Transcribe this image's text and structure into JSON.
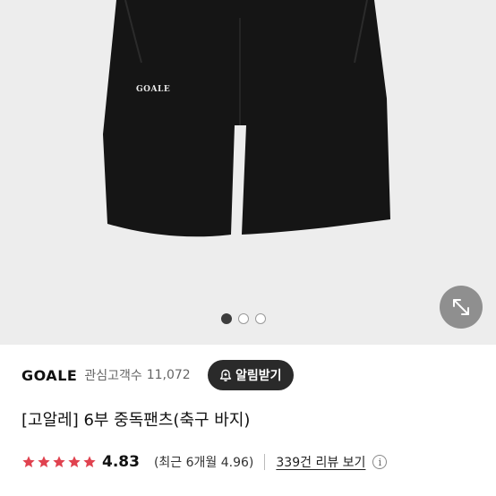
{
  "gallery": {
    "product_logo_text": "GOALE",
    "pages": 3,
    "active_page": 1,
    "expand_icon": "expand-diagonal-icon"
  },
  "brand": {
    "name": "GOALE",
    "favorites_label": "관심고객수",
    "favorites_count": "11,072",
    "alert_button_label": "알림받기",
    "alert_icon": "bell-plus-icon"
  },
  "product": {
    "title": "[고알레] 6부 중독팬츠(축구 바지)"
  },
  "rating": {
    "stars": 5,
    "score": "4.83",
    "recent_text": "(최근 6개월 4.96)",
    "review_link": "339건 리뷰 보기",
    "info_icon": "info-icon",
    "colors": {
      "star": "#e0424f"
    }
  }
}
